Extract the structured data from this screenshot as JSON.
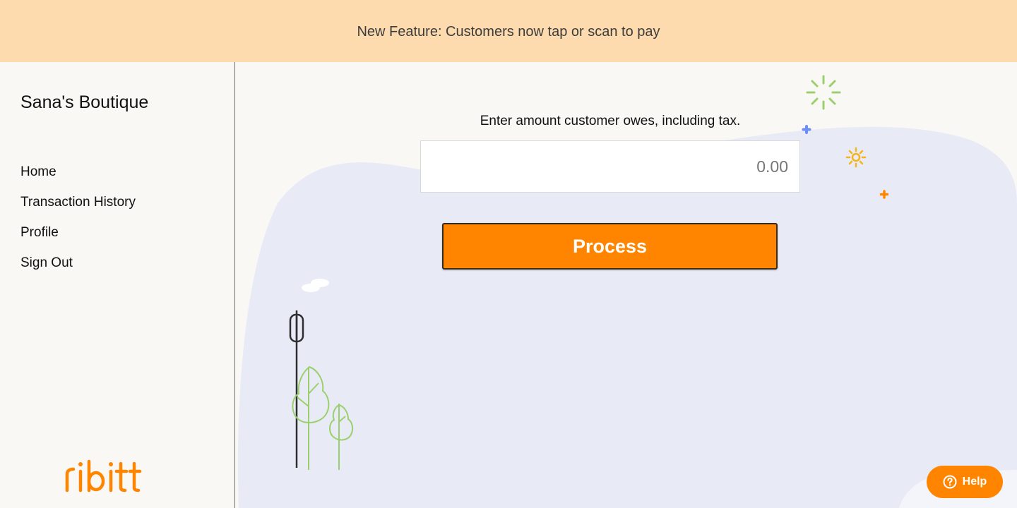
{
  "banner": {
    "text": "New Feature: Customers now tap or scan to pay"
  },
  "sidebar": {
    "store_name": "Sana's Boutique",
    "nav_items": [
      {
        "label": "Home"
      },
      {
        "label": "Transaction History"
      },
      {
        "label": "Profile"
      },
      {
        "label": "Sign Out"
      }
    ],
    "logo_text": "ribitt"
  },
  "main": {
    "prompt": "Enter amount customer owes, including tax.",
    "amount_placeholder": "0.00",
    "amount_value": "",
    "process_label": "Process"
  },
  "help": {
    "label": "Help",
    "icon": "question-circle-icon"
  },
  "colors": {
    "banner_bg": "#fddbae",
    "accent_orange": "#ff8500",
    "blob_blue": "#e8ebf5",
    "leaf_green": "#9bcf6e",
    "sun_yellow": "#f5b417",
    "sparkle_blue": "#6e8ef5"
  }
}
